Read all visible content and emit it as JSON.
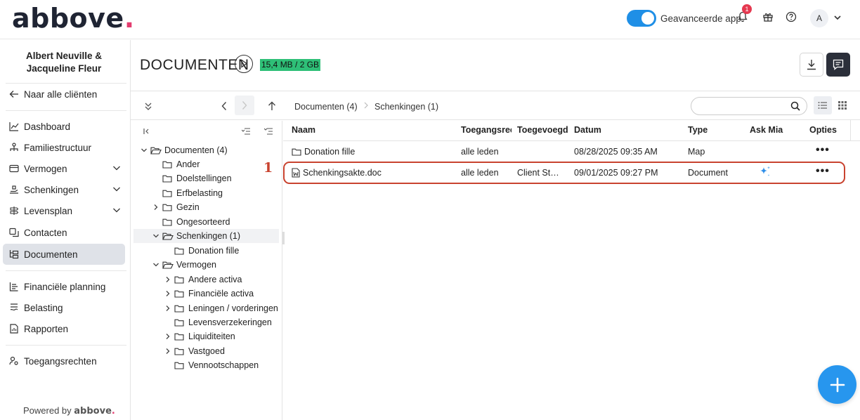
{
  "app": {
    "logo_text": "abbove",
    "logo_dot": ".",
    "advanced_app_label": "Geavanceerde app",
    "notification_count": "1",
    "avatar_initial": "A"
  },
  "sidebar": {
    "client_name_line1": "Albert Neuville &",
    "client_name_line2": "Jacqueline Fleur",
    "back_label": "Naar alle cliënten",
    "items": [
      {
        "label": "Dashboard"
      },
      {
        "label": "Familiestructuur"
      },
      {
        "label": "Vermogen"
      },
      {
        "label": "Schenkingen"
      },
      {
        "label": "Levensplan"
      },
      {
        "label": "Contacten"
      },
      {
        "label": "Documenten"
      },
      {
        "label": "Financiële planning"
      },
      {
        "label": "Belasting"
      },
      {
        "label": "Rapporten"
      },
      {
        "label": "Toegangsrechten"
      }
    ],
    "powered_by": "Powered by",
    "powered_brand": "abbove",
    "powered_dot": "."
  },
  "header": {
    "title": "DOCUMENTEN",
    "storage": "15,4 MB / 2 GB"
  },
  "breadcrumb": [
    "Documenten (4)",
    "Schenkingen (1)"
  ],
  "search": {
    "placeholder": ""
  },
  "tree": [
    {
      "label": "Documenten (4)"
    },
    {
      "label": "Ander"
    },
    {
      "label": "Doelstellingen"
    },
    {
      "label": "Erfbelasting"
    },
    {
      "label": "Gezin"
    },
    {
      "label": "Ongesorteerd"
    },
    {
      "label": "Schenkingen (1)"
    },
    {
      "label": "Donation fille"
    },
    {
      "label": "Vermogen"
    },
    {
      "label": "Andere activa"
    },
    {
      "label": "Financiële activa"
    },
    {
      "label": "Leningen / vorderingen"
    },
    {
      "label": "Levensverzekeringen"
    },
    {
      "label": "Liquiditeiten"
    },
    {
      "label": "Vastgoed"
    },
    {
      "label": "Vennootschappen"
    }
  ],
  "table": {
    "columns": [
      "Naam",
      "Toegangsrec",
      "Toegevoegd",
      "Datum",
      "Type",
      "Ask Mia",
      "Opties"
    ],
    "rows": [
      {
        "name": "Donation fille",
        "access": "alle leden",
        "added": "",
        "date": "08/28/2025 09:35 AM",
        "type": "Map",
        "options": "•••"
      },
      {
        "name": "Schenkingsakte.doc",
        "access": "alle leden",
        "added": "Client St…",
        "date": "09/01/2025 09:27 PM",
        "type": "Document",
        "options": "•••"
      }
    ]
  },
  "annotation_marker": "1",
  "colors": {
    "accent": "#2796ee",
    "brand_dot": "#e33d6f",
    "storage_bg": "#2ebf77",
    "highlight": "#c9432f"
  }
}
